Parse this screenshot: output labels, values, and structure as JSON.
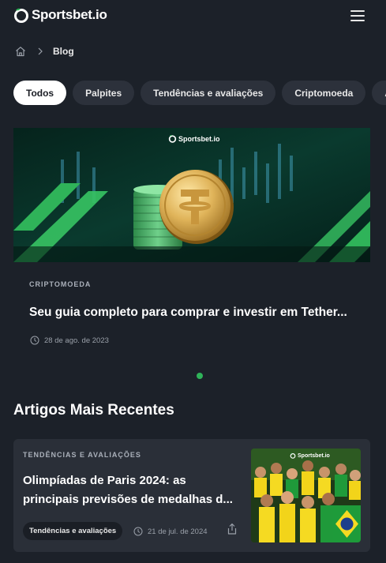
{
  "header": {
    "logo_text": "Sportsbet.io",
    "menu_icon": "hamburger-menu-icon"
  },
  "breadcrumb": {
    "home_icon": "home-icon",
    "separator_icon": "chevron-right-icon",
    "current": "Blog"
  },
  "categories": [
    {
      "label": "Todos",
      "active": true
    },
    {
      "label": "Palpites",
      "active": false
    },
    {
      "label": "Tendências e avaliações",
      "active": false
    },
    {
      "label": "Criptomoeda",
      "active": false
    },
    {
      "label": "A",
      "active": false
    }
  ],
  "featured": {
    "image_logo": "Sportsbet.io",
    "category": "CRIPTOMOEDA",
    "title": "Seu guia completo para comprar e investir em Tether...",
    "date": "28 de ago. de 2023"
  },
  "carousel": {
    "active_index": 0,
    "count": 1
  },
  "recent": {
    "section_title": "Artigos Mais Recentes",
    "articles": [
      {
        "category": "TENDÊNCIAS E AVALIAÇÕES",
        "title_line1": "Olimpíadas de Paris 2024: as",
        "title_line2": "principais previsões de medalhas d...",
        "tag": "Tendências e avaliações",
        "date": "21 de jul. de 2024",
        "image_logo": "Sportsbet.io",
        "share_icon": "share-icon"
      }
    ]
  },
  "colors": {
    "background": "#1c2129",
    "chip": "#2c313b",
    "chip_active": "#ffffff",
    "card": "#2a2f38",
    "accent": "#2fb359"
  }
}
